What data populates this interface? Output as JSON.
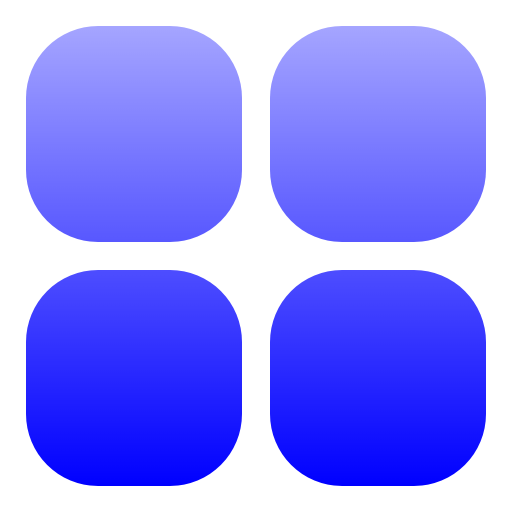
{
  "icon": {
    "name": "grid-four-tiles-icon",
    "gradient_top_color": "#A5A5FF",
    "gradient_bottom_color": "#0000FF",
    "tiles": [
      {
        "name": "tile-top-left"
      },
      {
        "name": "tile-top-right"
      },
      {
        "name": "tile-bottom-left"
      },
      {
        "name": "tile-bottom-right"
      }
    ]
  }
}
